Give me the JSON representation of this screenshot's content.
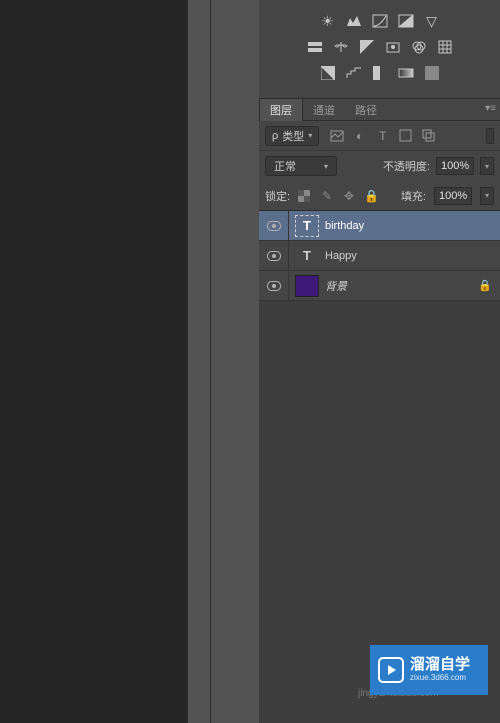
{
  "tabs": {
    "layers": "图层",
    "channels": "通道",
    "paths": "路径"
  },
  "filter": {
    "kind_label": "类型",
    "search_prefix": "ρ"
  },
  "blend": {
    "mode": "正常",
    "opacity_label": "不透明度:",
    "opacity_value": "100%"
  },
  "lock": {
    "label": "锁定:",
    "fill_label": "填充:",
    "fill_value": "100%"
  },
  "layers": [
    {
      "name": "birthday",
      "type": "text",
      "selected": true,
      "locked": false
    },
    {
      "name": "Happy",
      "type": "text",
      "selected": false,
      "locked": false
    },
    {
      "name": "背景",
      "type": "swatch",
      "color": "#3d1a7a",
      "selected": false,
      "locked": true,
      "italic": true
    }
  ],
  "watermark": "jingyan.baidu.com",
  "logo": {
    "main": "溜溜自学",
    "sub": "zixue.3d66.com"
  }
}
